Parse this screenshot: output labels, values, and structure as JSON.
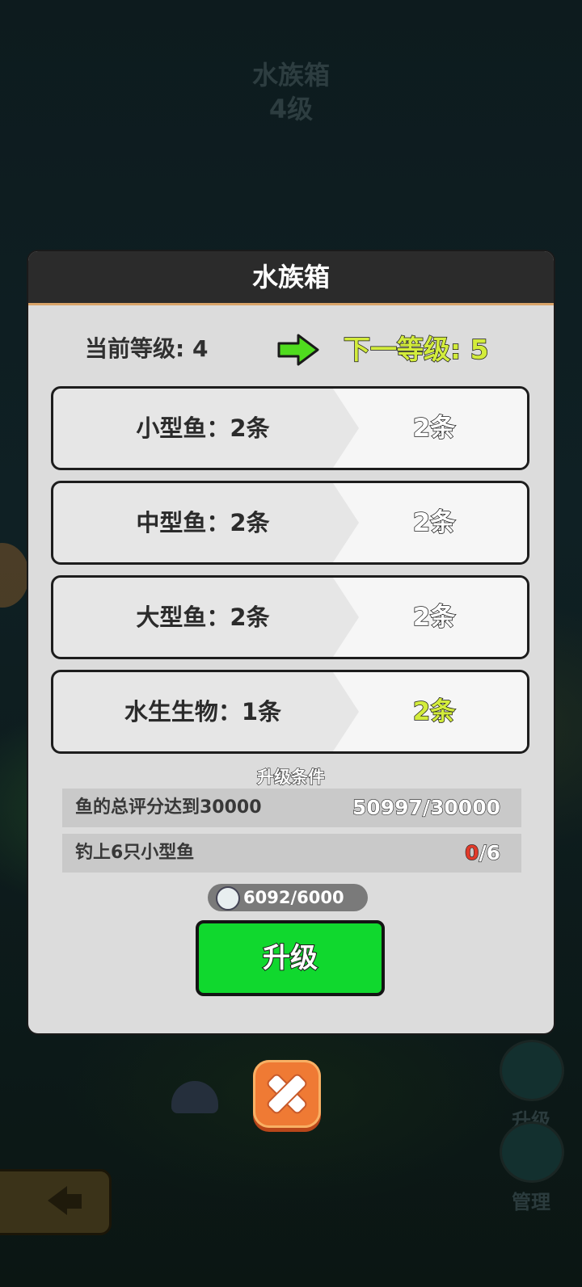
{
  "background": {
    "title": "水族箱",
    "level": "4级",
    "side_buttons": [
      {
        "label": "升级"
      },
      {
        "label": "管理"
      }
    ]
  },
  "dialog": {
    "title": "水族箱",
    "current_level": "当前等级: 4",
    "next_level": "下一等级: 5",
    "fish_rows": [
      {
        "label": "小型鱼：2条",
        "value": "2条",
        "highlight": false
      },
      {
        "label": "中型鱼：2条",
        "value": "2条",
        "highlight": false
      },
      {
        "label": "大型鱼：2条",
        "value": "2条",
        "highlight": false
      },
      {
        "label": "水生生物：1条",
        "value": "2条",
        "highlight": true
      }
    ],
    "conditions_title": "升级条件",
    "conditions": [
      {
        "label": "鱼的总评分达到30000",
        "progress": "50997",
        "target": "/30000"
      },
      {
        "label": "钓上6只小型鱼",
        "progress": "0",
        "target": "/6"
      }
    ],
    "cost": "6092/6000",
    "upgrade_label": "升级"
  },
  "icons": {
    "next": "green-arrow-right-icon",
    "coin": "coin-icon",
    "close": "close-icon",
    "back": "back-arrow-icon"
  },
  "colors": {
    "accent_green": "#10d82e",
    "next_level_text": "#d3ec3c",
    "close_orange": "#ef7a34",
    "incomplete_red": "#e03a2a"
  }
}
